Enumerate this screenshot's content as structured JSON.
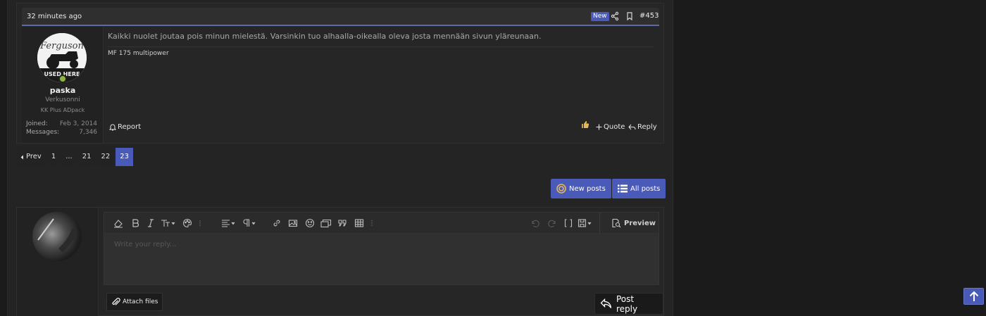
{
  "post": {
    "time": "32 minutes ago",
    "new_badge": "New",
    "number": "#453",
    "user": {
      "name": "paska",
      "title": "Verkusonni",
      "banner": "KK Plus ADpack",
      "joined_label": "Joined:",
      "joined": "Feb 3, 2014",
      "messages_label": "Messages:",
      "messages": "7,346",
      "avatar_logo_text": "Ferguson",
      "avatar_caption": "USED HERE"
    },
    "message": "Kaikki nuolet joutaa pois minun mielestä. Varsinkin tuo alhaalla-oikealla oleva josta mennään sivun yläreunaan.",
    "signature": "MF 175 multipower",
    "actions": {
      "report": "Report",
      "quote": "Quote",
      "reply": "Reply"
    }
  },
  "pagination": {
    "prev": "Prev",
    "pages": [
      "1",
      "...",
      "21",
      "22",
      "23"
    ],
    "current": "23"
  },
  "buttons": {
    "new_posts": "New posts",
    "all_posts": "All posts"
  },
  "editor": {
    "placeholder": "Write your reply...",
    "preview": "Preview",
    "attach": "Attach files",
    "post_reply": "Post reply"
  },
  "colors": {
    "accent": "#4a5ab8",
    "online": "#8db63f",
    "background": "#1b1b1b"
  }
}
